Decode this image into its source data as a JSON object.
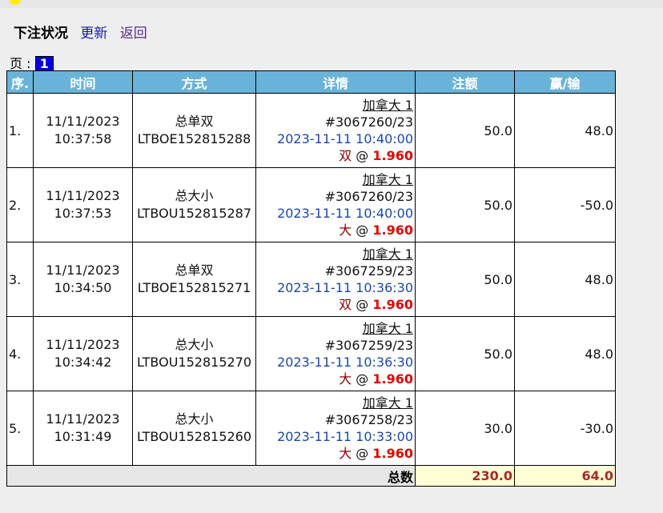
{
  "header": {
    "title": "下注状况",
    "refresh": "更新",
    "back": "返回"
  },
  "pager": {
    "label": "页 : ",
    "current": "1"
  },
  "columns": [
    "序.",
    "时间",
    "方式",
    "详情",
    "注额",
    "赢/输"
  ],
  "rows": [
    {
      "seq": "1.",
      "date": "11/11/2023",
      "time": "10:37:58",
      "type": "总单双",
      "code": "LTBOE152815288",
      "market": "加拿大 1",
      "draw": "#3067260/23",
      "draw_time": "2023-11-11 10:40:00",
      "selection": "双",
      "odds": "1.960",
      "stake": "50.0",
      "result": "48.0"
    },
    {
      "seq": "2.",
      "date": "11/11/2023",
      "time": "10:37:53",
      "type": "总大小",
      "code": "LTBOU152815287",
      "market": "加拿大 1",
      "draw": "#3067260/23",
      "draw_time": "2023-11-11 10:40:00",
      "selection": "大",
      "odds": "1.960",
      "stake": "50.0",
      "result": "-50.0"
    },
    {
      "seq": "3.",
      "date": "11/11/2023",
      "time": "10:34:50",
      "type": "总单双",
      "code": "LTBOE152815271",
      "market": "加拿大 1",
      "draw": "#3067259/23",
      "draw_time": "2023-11-11 10:36:30",
      "selection": "双",
      "odds": "1.960",
      "stake": "50.0",
      "result": "48.0"
    },
    {
      "seq": "4.",
      "date": "11/11/2023",
      "time": "10:34:42",
      "type": "总大小",
      "code": "LTBOU152815270",
      "market": "加拿大 1",
      "draw": "#3067259/23",
      "draw_time": "2023-11-11 10:36:30",
      "selection": "大",
      "odds": "1.960",
      "stake": "50.0",
      "result": "48.0"
    },
    {
      "seq": "5.",
      "date": "11/11/2023",
      "time": "10:31:49",
      "type": "总大小",
      "code": "LTBOU152815260",
      "market": "加拿大 1",
      "draw": "#3067258/23",
      "draw_time": "2023-11-11 10:33:00",
      "selection": "大",
      "odds": "1.960",
      "stake": "30.0",
      "result": "-30.0"
    }
  ],
  "total": {
    "label": "总数",
    "stake": "230.0",
    "result": "64.0"
  }
}
